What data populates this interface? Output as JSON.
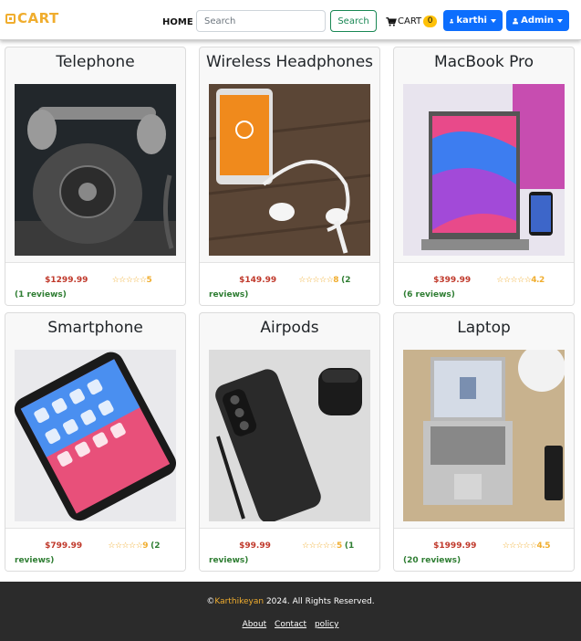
{
  "brand": {
    "logo_text": "CART"
  },
  "nav": {
    "home": "HOME",
    "search_placeholder": "Search",
    "search_button": "Search",
    "cart_label": "CART",
    "cart_count": "0",
    "user_menu": "karthi",
    "admin_menu": "Admin"
  },
  "products": [
    {
      "name": "Telephone",
      "price": "$1299.99",
      "rating": "5",
      "reviews": "(1 reviews)"
    },
    {
      "name": "Wireless Headphones",
      "price": "$149.99",
      "rating": "8",
      "reviews": "(2 reviews)"
    },
    {
      "name": "MacBook Pro",
      "price": "$399.99",
      "rating": "4.2",
      "reviews": "(6 reviews)"
    },
    {
      "name": "Smartphone",
      "price": "$799.99",
      "rating": "9",
      "reviews": "(2 reviews)"
    },
    {
      "name": "Airpods",
      "price": "$99.99",
      "rating": "5",
      "reviews": "(1 reviews)"
    },
    {
      "name": "Laptop",
      "price": "$1999.99",
      "rating": "4.5",
      "reviews": "(20 reviews)"
    }
  ],
  "stars_glyphs": "☆☆☆☆☆",
  "footer": {
    "copyright_symbol": "©",
    "author": "Karthikeyan",
    "copyright_rest": " 2024. All Rights Reserved.",
    "links": [
      "About",
      "Contact",
      "policy"
    ]
  },
  "colors": {
    "brand": "#f0ad2e",
    "primary": "#0d6efd",
    "success": "#198754",
    "price": "#c0392b"
  }
}
